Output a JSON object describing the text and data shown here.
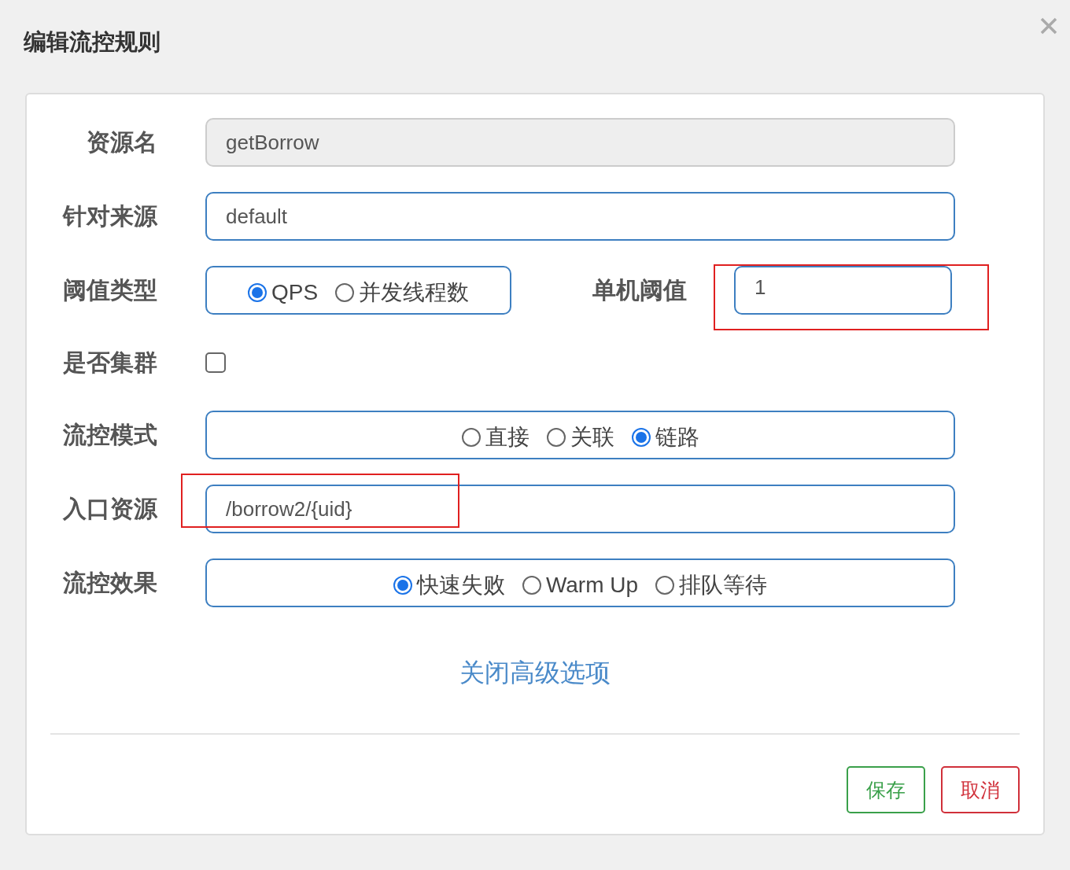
{
  "dialog": {
    "title": "编辑流控规则"
  },
  "rows": [
    {
      "kind": "text",
      "label": "资源名",
      "value": "getBorrow",
      "disabled": true,
      "highlighted": false
    },
    {
      "kind": "text",
      "label": "针对来源",
      "value": "default",
      "disabled": false,
      "highlighted": false
    },
    {
      "kind": "threshold",
      "label": "阈值类型",
      "options": [
        {
          "label": "QPS",
          "selected": true
        },
        {
          "label": "并发线程数",
          "selected": false
        }
      ],
      "side_label": "单机阈值",
      "side_value": "1",
      "side_highlighted": true
    },
    {
      "kind": "checkbox",
      "label": "是否集群",
      "checked": false
    },
    {
      "kind": "radio",
      "label": "流控模式",
      "options": [
        {
          "label": "直接",
          "selected": false
        },
        {
          "label": "关联",
          "selected": false
        },
        {
          "label": "链路",
          "selected": true
        }
      ]
    },
    {
      "kind": "text",
      "label": "入口资源",
      "value": "/borrow2/{uid}",
      "disabled": false,
      "highlighted": true
    },
    {
      "kind": "radio",
      "label": "流控效果",
      "options": [
        {
          "label": "快速失败",
          "selected": true
        },
        {
          "label": "Warm Up",
          "selected": false
        },
        {
          "label": "排队等待",
          "selected": false
        }
      ]
    }
  ],
  "link": "关闭高级选项",
  "buttons": [
    {
      "kind": "save",
      "label": "保存"
    },
    {
      "kind": "cancel",
      "label": "取消"
    }
  ]
}
